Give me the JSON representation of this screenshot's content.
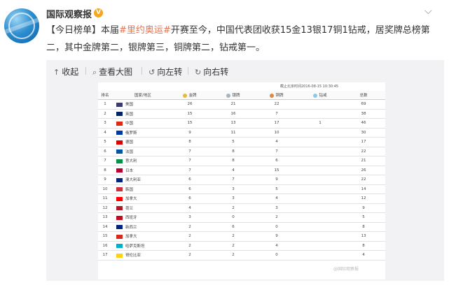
{
  "post": {
    "username": "国际观察报",
    "verified_badge": "V",
    "menu_icon": "chevron-down-icon",
    "text": {
      "prefix": "【今日榜单】本届",
      "hashtag": "#里约奥运#",
      "body": "开赛至今，中国代表团收获15金13银17铜1钻戒，居奖牌总榜第二，其中金牌第二，银牌第三，铜牌第二，钻戒第一。"
    }
  },
  "toolbar": {
    "collapse": {
      "icon": "up-arrow-icon",
      "label": "收起"
    },
    "view_large": {
      "icon": "magnifier-icon",
      "label": "查看大图"
    },
    "rotate_left": {
      "icon": "rotate-left-icon",
      "label": "向左转"
    },
    "rotate_right": {
      "icon": "rotate-right-icon",
      "label": "向右转"
    }
  },
  "medal_table": {
    "cutoff_note": "截止北京时间2016-08-15 10:30:45",
    "headers": [
      "排名",
      "国家/地区",
      "金牌",
      "银牌",
      "铜牌",
      "钻戒",
      "总数"
    ],
    "rows": [
      {
        "rank": "1",
        "country": "美国",
        "gold": "26",
        "silver": "21",
        "bronze": "22",
        "ring": "",
        "total": "69",
        "flag": "#3c3b6e"
      },
      {
        "rank": "2",
        "country": "英国",
        "gold": "15",
        "silver": "16",
        "bronze": "7",
        "ring": "",
        "total": "38",
        "flag": "#012169"
      },
      {
        "rank": "3",
        "country": "中国",
        "gold": "15",
        "silver": "13",
        "bronze": "17",
        "ring": "1",
        "total": "46",
        "flag": "#de2910"
      },
      {
        "rank": "4",
        "country": "俄罗斯",
        "gold": "9",
        "silver": "11",
        "bronze": "10",
        "ring": "",
        "total": "30",
        "flag": "#0039a6"
      },
      {
        "rank": "5",
        "country": "德国",
        "gold": "8",
        "silver": "5",
        "bronze": "4",
        "ring": "",
        "total": "17",
        "flag": "#dd0000"
      },
      {
        "rank": "6",
        "country": "法国",
        "gold": "7",
        "silver": "8",
        "bronze": "7",
        "ring": "",
        "total": "22",
        "flag": "#0055a4"
      },
      {
        "rank": "7",
        "country": "意大利",
        "gold": "7",
        "silver": "8",
        "bronze": "6",
        "ring": "",
        "total": "21",
        "flag": "#009246"
      },
      {
        "rank": "8",
        "country": "日本",
        "gold": "7",
        "silver": "4",
        "bronze": "15",
        "ring": "",
        "total": "26",
        "flag": "#bc002d"
      },
      {
        "rank": "9",
        "country": "澳大利亚",
        "gold": "6",
        "silver": "7",
        "bronze": "9",
        "ring": "",
        "total": "22",
        "flag": "#00247d"
      },
      {
        "rank": "10",
        "country": "韩国",
        "gold": "6",
        "silver": "3",
        "bronze": "5",
        "ring": "",
        "total": "14",
        "flag": "#cd2e3a"
      },
      {
        "rank": "11",
        "country": "加拿大",
        "gold": "6",
        "silver": "3",
        "bronze": "4",
        "ring": "",
        "total": "12",
        "flag": "#ff0000"
      },
      {
        "rank": "12",
        "country": "荷兰",
        "gold": "4",
        "silver": "2",
        "bronze": "3",
        "ring": "",
        "total": "9",
        "flag": "#ae1c28"
      },
      {
        "rank": "13",
        "country": "西班牙",
        "gold": "3",
        "silver": "0",
        "bronze": "2",
        "ring": "",
        "total": "5",
        "flag": "#c60b1e"
      },
      {
        "rank": "14",
        "country": "新西兰",
        "gold": "2",
        "silver": "6",
        "bronze": "0",
        "ring": "",
        "total": "8",
        "flag": "#00247d"
      },
      {
        "rank": "15",
        "country": "加拿大",
        "gold": "2",
        "silver": "2",
        "bronze": "9",
        "ring": "",
        "total": "13",
        "flag": "#d52b1e"
      },
      {
        "rank": "16",
        "country": "哈萨克斯坦",
        "gold": "2",
        "silver": "2",
        "bronze": "4",
        "ring": "",
        "total": "8",
        "flag": "#00afca"
      },
      {
        "rank": "17",
        "country": "哥伦比亚",
        "gold": "2",
        "silver": "2",
        "bronze": "0",
        "ring": "",
        "total": "4",
        "flag": "#fcd116"
      }
    ],
    "medal_colors": {
      "gold": "#e8b93b",
      "silver": "#a9b4c2",
      "bronze": "#d98a4a",
      "ring": "#8fc7e8"
    },
    "watermark": "@国际观察报"
  }
}
